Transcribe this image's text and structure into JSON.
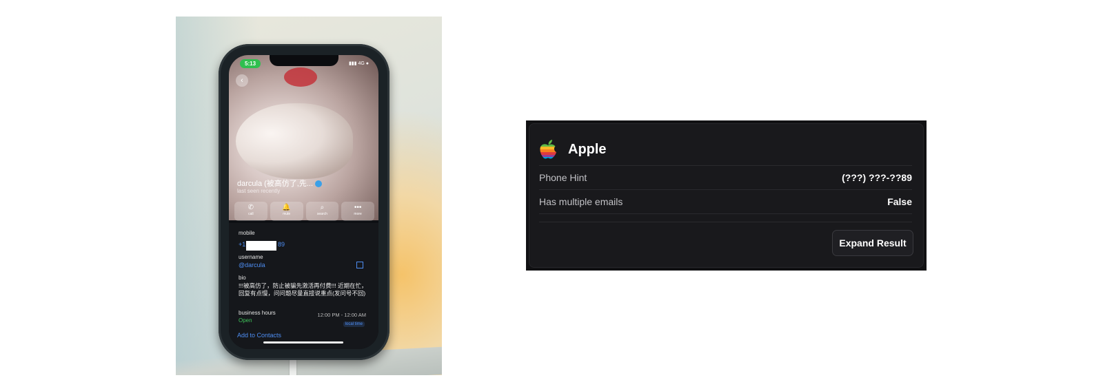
{
  "phone": {
    "status_time": "5:13",
    "status_signal": "4G",
    "contact_name": "darcula (被高仿了,先...",
    "last_seen": "last seen recently",
    "actions": [
      {
        "icon": "phone-icon",
        "label": "call"
      },
      {
        "icon": "bell-icon",
        "label": "mute"
      },
      {
        "icon": "search-icon",
        "label": "search"
      },
      {
        "icon": "more-icon",
        "label": "more"
      }
    ],
    "mobile_label": "mobile",
    "mobile_value_prefix": "+1",
    "mobile_value_suffix": "89",
    "username_label": "username",
    "username_value": "@darcula",
    "bio_label": "bio",
    "bio_text": "!!!被高仿了，防止被骗先激活再付费!!! 近期在忙，回复有点慢，问问题尽量直接说重点(发问号不回)",
    "business_hours_label": "business hours",
    "business_status": "Open",
    "business_hours_value": "12:00 PM - 12:00 AM",
    "local_time_label": "local time",
    "add_contacts": "Add to Contacts"
  },
  "card": {
    "title": "Apple",
    "icon": "apple-logo-icon",
    "rows": [
      {
        "key": "Phone Hint",
        "value": "(???) ???-??89"
      },
      {
        "key": "Has multiple emails",
        "value": "False"
      }
    ],
    "expand_label": "Expand Result"
  }
}
